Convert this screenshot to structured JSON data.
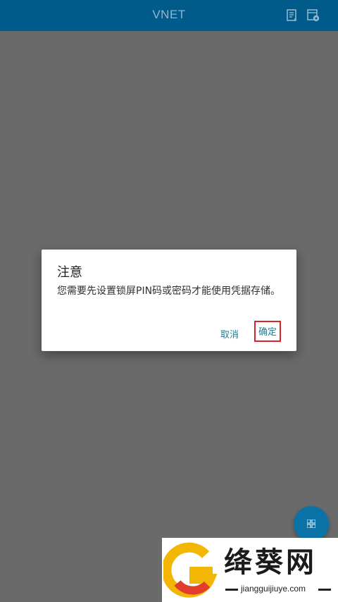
{
  "appbar": {
    "title": "VNET",
    "icons": [
      "document-list-icon",
      "settings-calendar-icon"
    ]
  },
  "dialog": {
    "title": "注意",
    "message": "您需要先设置锁屏PIN码或密码才能使用凭据存储。",
    "cancel_label": "取消",
    "ok_label": "确定"
  },
  "fab": {
    "icon": "grid-icon"
  },
  "watermark": {
    "brand": "绛葵网",
    "url": "jiangguijiuye.com"
  },
  "colors": {
    "appbar": "#005b8a",
    "scrim": "#6a6a6a",
    "button_text": "#1f7f92",
    "highlight": "#d9252a",
    "fab": "#0a72a6"
  }
}
